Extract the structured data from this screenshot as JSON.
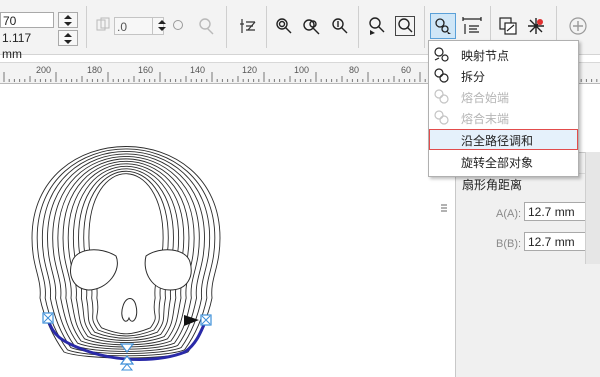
{
  "toolbar": {
    "field_top_value": "70",
    "field_bottom_value": "1.117 mm",
    "blend_steps_value": ".0",
    "buttons": [
      "blend-direction",
      "object-acceleration",
      "color-acceleration",
      "start-object",
      "end-object",
      "path-properties",
      "blend-options"
    ]
  },
  "ruler": {
    "labels": [
      "200",
      "180",
      "160",
      "140",
      "120",
      "100",
      "80",
      "60"
    ]
  },
  "context_menu": {
    "items": [
      {
        "label": "映射节点",
        "enabled": true,
        "icon": "map-nodes-icon"
      },
      {
        "label": "拆分",
        "enabled": true,
        "icon": "split-icon"
      },
      {
        "label": "熔合始端",
        "enabled": false,
        "icon": "fuse-start-icon"
      },
      {
        "label": "熔合末端",
        "enabled": false,
        "icon": "fuse-end-icon"
      },
      {
        "label": "沿全路径调和",
        "enabled": true,
        "highlighted": true
      },
      {
        "label": "旋转全部对象",
        "enabled": true
      }
    ]
  },
  "panel": {
    "section_label": "扇形角距离",
    "field_a_label": "A(A):",
    "field_a_value": "12.7 mm",
    "field_b_label": "B(B):",
    "field_b_value": "12.7 mm"
  },
  "colors": {
    "menu_highlight_border": "#e24c4c",
    "menu_highlight_bg": "#e5f1fb",
    "pressed_button_bg": "#cfe6f7",
    "selection_handle": "#3d8fd8",
    "path_accent": "#2a2aa8"
  }
}
